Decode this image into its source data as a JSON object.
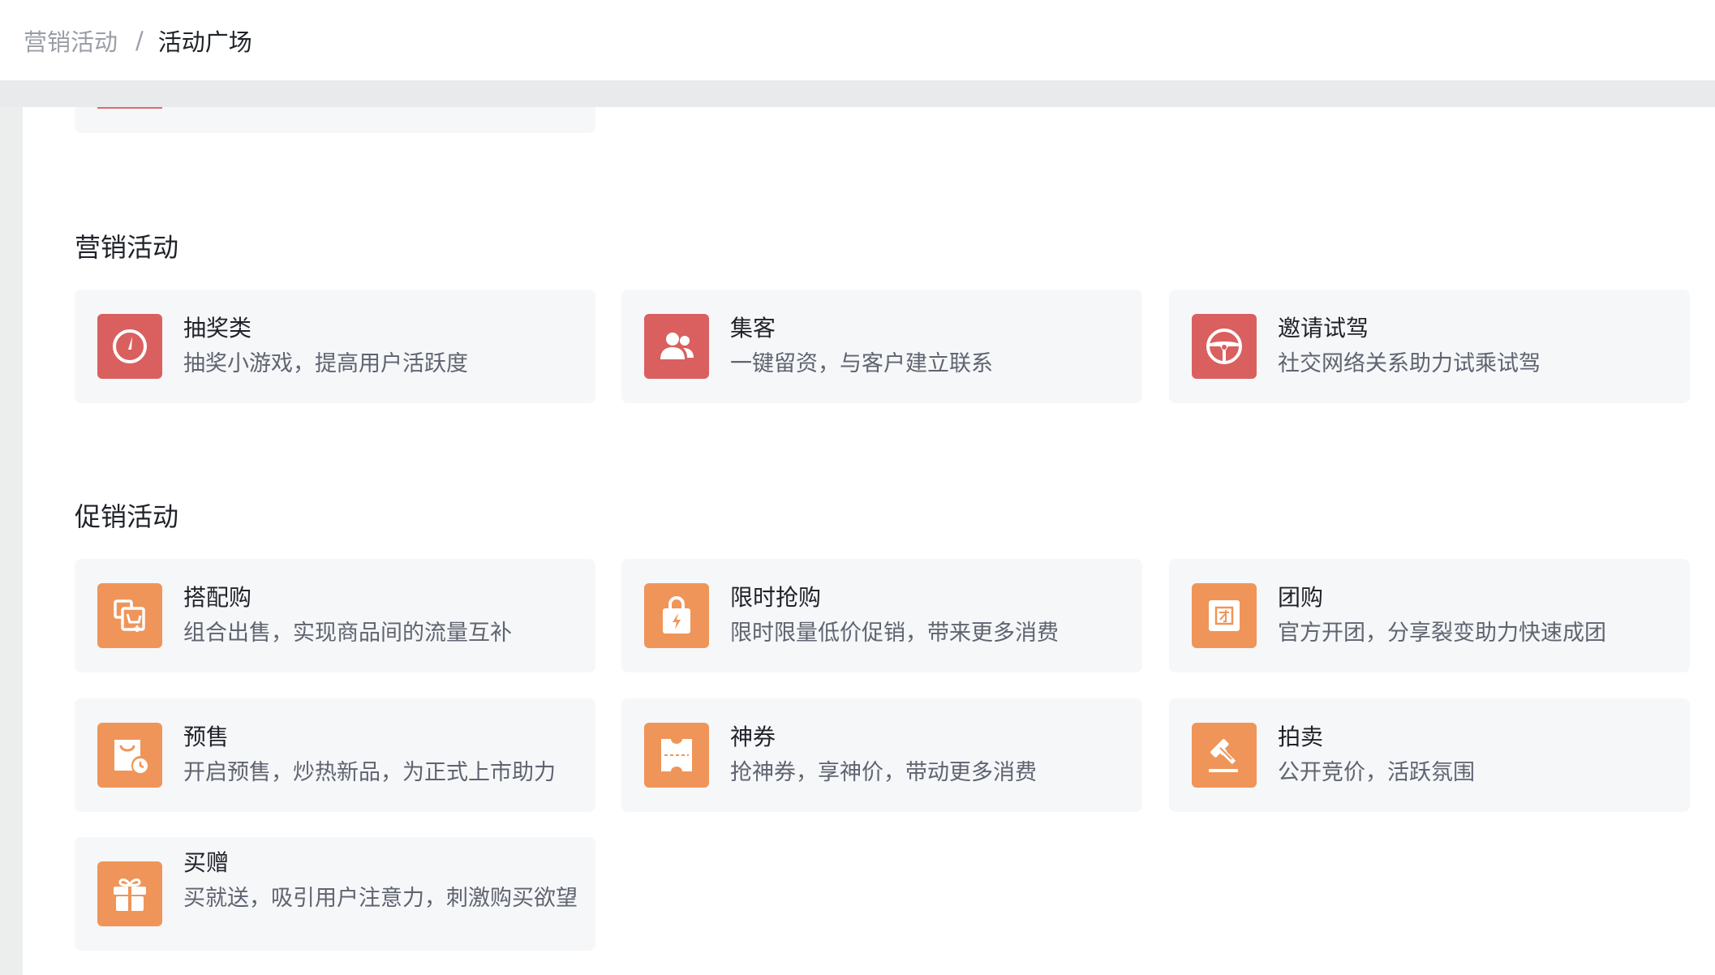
{
  "breadcrumb": {
    "parent": "营销活动",
    "separator": "/",
    "current": "活动广场"
  },
  "sections": {
    "marketing": {
      "title": "营销活动",
      "cards": [
        {
          "title": "抽奖类",
          "desc": "抽奖小游戏，提高用户活跃度",
          "icon": "lottery-dial-icon"
        },
        {
          "title": "集客",
          "desc": "一键留资，与客户建立联系",
          "icon": "users-icon"
        },
        {
          "title": "邀请试驾",
          "desc": "社交网络关系助力试乘试驾",
          "icon": "steering-wheel-icon"
        }
      ]
    },
    "promotion": {
      "title": "促销活动",
      "cards": [
        {
          "title": "搭配购",
          "desc": "组合出售，实现商品间的流量互补",
          "icon": "bundle-cart-icon"
        },
        {
          "title": "限时抢购",
          "desc": "限时限量低价促销，带来更多消费",
          "icon": "flash-bag-icon"
        },
        {
          "title": "团购",
          "desc": "官方开团，分享裂变助力快速成团",
          "icon": "group-buy-icon"
        },
        {
          "title": "预售",
          "desc": "开启预售，炒热新品，为正式上市助力",
          "icon": "presale-bag-icon"
        },
        {
          "title": "神券",
          "desc": "抢神券，享神价，带动更多消费",
          "icon": "coupon-icon"
        },
        {
          "title": "拍卖",
          "desc": "公开竞价，活跃氛围",
          "icon": "gavel-icon"
        },
        {
          "title": "买赠",
          "desc": "买就送，吸引用户注意力，刺激购买欲望",
          "icon": "gift-icon"
        }
      ]
    }
  },
  "colors": {
    "marketing_icon_bg": "#d9605f",
    "promotion_icon_bg": "#ef9559",
    "card_bg": "#f6f7f9"
  }
}
